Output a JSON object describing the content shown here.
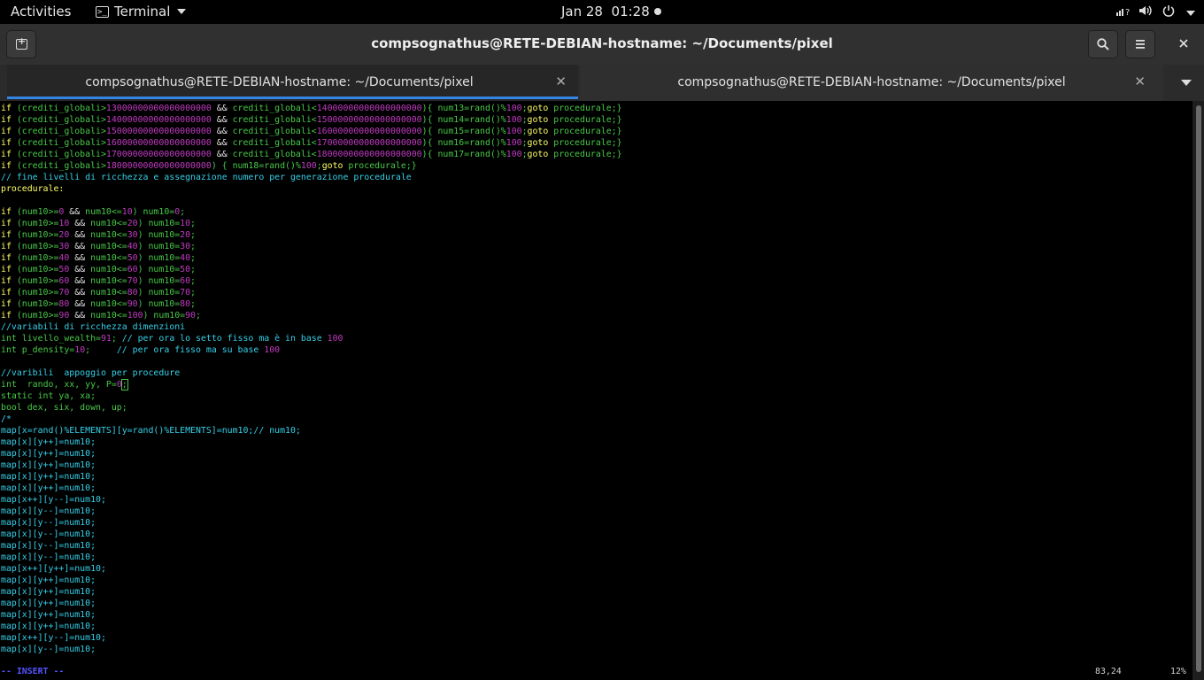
{
  "topbar": {
    "activities": "Activities",
    "app_name": "Terminal",
    "date": "Jan 28",
    "time": "01:28",
    "tray_icons": [
      "network-icon",
      "volume-icon",
      "power-icon"
    ]
  },
  "window": {
    "title": "compsognathus@RETE-DEBIAN-hostname: ~/Documents/pixel",
    "buttons": [
      "new-tab",
      "search",
      "menu",
      "close"
    ]
  },
  "tabs": [
    {
      "label": "compsognathus@RETE-DEBIAN-hostname: ~/Documents/pixel",
      "active": true
    },
    {
      "label": "compsognathus@RETE-DEBIAN-hostname: ~/Documents/pixel",
      "active": false
    }
  ],
  "editor": {
    "lines": [
      [
        [
          "k",
          "if"
        ],
        [
          "v",
          " (crediti_globali>"
        ],
        [
          "n",
          "13000000000000000000"
        ],
        [
          "w",
          " && "
        ],
        [
          "v",
          "crediti_globali<"
        ],
        [
          "n",
          "14000000000000000000"
        ],
        [
          "v",
          "){ num13=rand()%"
        ],
        [
          "n",
          "100"
        ],
        [
          "v",
          ";"
        ],
        [
          "k",
          "goto"
        ],
        [
          "v",
          " procedurale;}"
        ]
      ],
      [
        [
          "k",
          "if"
        ],
        [
          "v",
          " (crediti_globali>"
        ],
        [
          "n",
          "14000000000000000000"
        ],
        [
          "w",
          " && "
        ],
        [
          "v",
          "crediti_globali<"
        ],
        [
          "n",
          "15000000000000000000"
        ],
        [
          "v",
          "){ num14=rand()%"
        ],
        [
          "n",
          "100"
        ],
        [
          "v",
          ";"
        ],
        [
          "k",
          "goto"
        ],
        [
          "v",
          " procedurale;}"
        ]
      ],
      [
        [
          "k",
          "if"
        ],
        [
          "v",
          " (crediti_globali>"
        ],
        [
          "n",
          "15000000000000000000"
        ],
        [
          "w",
          " && "
        ],
        [
          "v",
          "crediti_globali<"
        ],
        [
          "n",
          "16000000000000000000"
        ],
        [
          "v",
          "){ num15=rand()%"
        ],
        [
          "n",
          "100"
        ],
        [
          "v",
          ";"
        ],
        [
          "k",
          "goto"
        ],
        [
          "v",
          " procedurale;}"
        ]
      ],
      [
        [
          "k",
          "if"
        ],
        [
          "v",
          " (crediti_globali>"
        ],
        [
          "n",
          "16000000000000000000"
        ],
        [
          "w",
          " && "
        ],
        [
          "v",
          "crediti_globali<"
        ],
        [
          "n",
          "17000000000000000000"
        ],
        [
          "v",
          "){ num16=rand()%"
        ],
        [
          "n",
          "100"
        ],
        [
          "v",
          ";"
        ],
        [
          "k",
          "goto"
        ],
        [
          "v",
          " procedurale;}"
        ]
      ],
      [
        [
          "k",
          "if"
        ],
        [
          "v",
          " (crediti_globali>"
        ],
        [
          "n",
          "17000000000000000000"
        ],
        [
          "w",
          " && "
        ],
        [
          "v",
          "crediti_globali<"
        ],
        [
          "n",
          "18000000000000000000"
        ],
        [
          "v",
          "){ num17=rand()%"
        ],
        [
          "n",
          "100"
        ],
        [
          "v",
          ";"
        ],
        [
          "k",
          "goto"
        ],
        [
          "v",
          " procedurale;}"
        ]
      ],
      [
        [
          "k",
          "if"
        ],
        [
          "v",
          " (crediti_globali>"
        ],
        [
          "n",
          "18000000000000000000"
        ],
        [
          "v",
          ") { num18=rand()%"
        ],
        [
          "n",
          "100"
        ],
        [
          "v",
          ";"
        ],
        [
          "k",
          "goto"
        ],
        [
          "v",
          " procedurale;}"
        ]
      ],
      [
        [
          "c",
          "// fine livelli di ricchezza e assegnazione numero per generazione procedurale"
        ]
      ],
      [
        [
          "k",
          "procedurale:"
        ]
      ],
      [
        [
          "w",
          ""
        ]
      ],
      [
        [
          "k",
          "if"
        ],
        [
          "v",
          " (num10>="
        ],
        [
          "n",
          "0"
        ],
        [
          "w",
          " && "
        ],
        [
          "v",
          "num10<="
        ],
        [
          "n",
          "10"
        ],
        [
          "v",
          ") num10="
        ],
        [
          "n",
          "0"
        ],
        [
          "v",
          ";"
        ]
      ],
      [
        [
          "k",
          "if"
        ],
        [
          "v",
          " (num10>="
        ],
        [
          "n",
          "10"
        ],
        [
          "w",
          " && "
        ],
        [
          "v",
          "num10<="
        ],
        [
          "n",
          "20"
        ],
        [
          "v",
          ") num10="
        ],
        [
          "n",
          "10"
        ],
        [
          "v",
          ";"
        ]
      ],
      [
        [
          "k",
          "if"
        ],
        [
          "v",
          " (num10>="
        ],
        [
          "n",
          "20"
        ],
        [
          "w",
          " && "
        ],
        [
          "v",
          "num10<="
        ],
        [
          "n",
          "30"
        ],
        [
          "v",
          ") num10="
        ],
        [
          "n",
          "20"
        ],
        [
          "v",
          ";"
        ]
      ],
      [
        [
          "k",
          "if"
        ],
        [
          "v",
          " (num10>="
        ],
        [
          "n",
          "30"
        ],
        [
          "w",
          " && "
        ],
        [
          "v",
          "num10<="
        ],
        [
          "n",
          "40"
        ],
        [
          "v",
          ") num10="
        ],
        [
          "n",
          "30"
        ],
        [
          "v",
          ";"
        ]
      ],
      [
        [
          "k",
          "if"
        ],
        [
          "v",
          " (num10>="
        ],
        [
          "n",
          "40"
        ],
        [
          "w",
          " && "
        ],
        [
          "v",
          "num10<="
        ],
        [
          "n",
          "50"
        ],
        [
          "v",
          ") num10="
        ],
        [
          "n",
          "40"
        ],
        [
          "v",
          ";"
        ]
      ],
      [
        [
          "k",
          "if"
        ],
        [
          "v",
          " (num10>="
        ],
        [
          "n",
          "50"
        ],
        [
          "w",
          " && "
        ],
        [
          "v",
          "num10<="
        ],
        [
          "n",
          "60"
        ],
        [
          "v",
          ") num10="
        ],
        [
          "n",
          "50"
        ],
        [
          "v",
          ";"
        ]
      ],
      [
        [
          "k",
          "if"
        ],
        [
          "v",
          " (num10>="
        ],
        [
          "n",
          "60"
        ],
        [
          "w",
          " && "
        ],
        [
          "v",
          "num10<="
        ],
        [
          "n",
          "70"
        ],
        [
          "v",
          ") num10="
        ],
        [
          "n",
          "60"
        ],
        [
          "v",
          ";"
        ]
      ],
      [
        [
          "k",
          "if"
        ],
        [
          "v",
          " (num10>="
        ],
        [
          "n",
          "70"
        ],
        [
          "w",
          " && "
        ],
        [
          "v",
          "num10<="
        ],
        [
          "n",
          "80"
        ],
        [
          "v",
          ") num10="
        ],
        [
          "n",
          "70"
        ],
        [
          "v",
          ";"
        ]
      ],
      [
        [
          "k",
          "if"
        ],
        [
          "v",
          " (num10>="
        ],
        [
          "n",
          "80"
        ],
        [
          "w",
          " && "
        ],
        [
          "v",
          "num10<="
        ],
        [
          "n",
          "90"
        ],
        [
          "v",
          ") num10="
        ],
        [
          "n",
          "80"
        ],
        [
          "v",
          ";"
        ]
      ],
      [
        [
          "k",
          "if"
        ],
        [
          "v",
          " (num10>="
        ],
        [
          "n",
          "90"
        ],
        [
          "w",
          " && "
        ],
        [
          "v",
          "num10<="
        ],
        [
          "n",
          "100"
        ],
        [
          "v",
          ") num10="
        ],
        [
          "n",
          "90"
        ],
        [
          "v",
          ";"
        ]
      ],
      [
        [
          "c",
          "//variabili di ricchezza dimenzioni"
        ]
      ],
      [
        [
          "v",
          "int"
        ],
        [
          "v",
          " livello_wealth="
        ],
        [
          "n",
          "91"
        ],
        [
          "v",
          "; "
        ],
        [
          "c",
          "// per ora lo setto fisso ma è in base "
        ],
        [
          "n",
          "100"
        ]
      ],
      [
        [
          "v",
          "int"
        ],
        [
          "v",
          " p_density="
        ],
        [
          "n",
          "10"
        ],
        [
          "v",
          ";     "
        ],
        [
          "c",
          "// per ora fisso ma su base "
        ],
        [
          "n",
          "100"
        ]
      ],
      [
        [
          "w",
          ""
        ]
      ],
      [
        [
          "c",
          "//varibili  appoggio per procedure"
        ]
      ],
      [
        [
          "v",
          "int"
        ],
        [
          "v",
          "  rando, xx, yy, P="
        ],
        [
          "n",
          "0"
        ],
        [
          "cur",
          ";"
        ]
      ],
      [
        [
          "v",
          "static int"
        ],
        [
          "v",
          " ya, xa;"
        ]
      ],
      [
        [
          "v",
          "bool"
        ],
        [
          "v",
          " dex, six, down, up;"
        ]
      ],
      [
        [
          "c",
          "/*"
        ]
      ],
      [
        [
          "c",
          "map[x=rand()%ELEMENTS][y=rand()%ELEMENTS]=num10;// num10;"
        ]
      ],
      [
        [
          "c",
          "map[x][y++]=num10;"
        ]
      ],
      [
        [
          "c",
          "map[x][y++]=num10;"
        ]
      ],
      [
        [
          "c",
          "map[x][y++]=num10;"
        ]
      ],
      [
        [
          "c",
          "map[x][y++]=num10;"
        ]
      ],
      [
        [
          "c",
          "map[x][y++]=num10;"
        ]
      ],
      [
        [
          "c",
          "map[x++][y--]=num10;"
        ]
      ],
      [
        [
          "c",
          "map[x][y--]=num10;"
        ]
      ],
      [
        [
          "c",
          "map[x][y--]=num10;"
        ]
      ],
      [
        [
          "c",
          "map[x][y--]=num10;"
        ]
      ],
      [
        [
          "c",
          "map[x][y--]=num10;"
        ]
      ],
      [
        [
          "c",
          "map[x][y--]=num10;"
        ]
      ],
      [
        [
          "c",
          "map[x++][y++]=num10;"
        ]
      ],
      [
        [
          "c",
          "map[x][y++]=num10;"
        ]
      ],
      [
        [
          "c",
          "map[x][y++]=num10;"
        ]
      ],
      [
        [
          "c",
          "map[x][y++]=num10;"
        ]
      ],
      [
        [
          "c",
          "map[x][y++]=num10;"
        ]
      ],
      [
        [
          "c",
          "map[x][y++]=num10;"
        ]
      ],
      [
        [
          "c",
          "map[x++][y--]=num10;"
        ]
      ],
      [
        [
          "c",
          "map[x][y--]=num10;"
        ]
      ]
    ],
    "status_mode": "-- INSERT --",
    "cursor_pos": "83,24",
    "scroll_pct": "12%"
  }
}
